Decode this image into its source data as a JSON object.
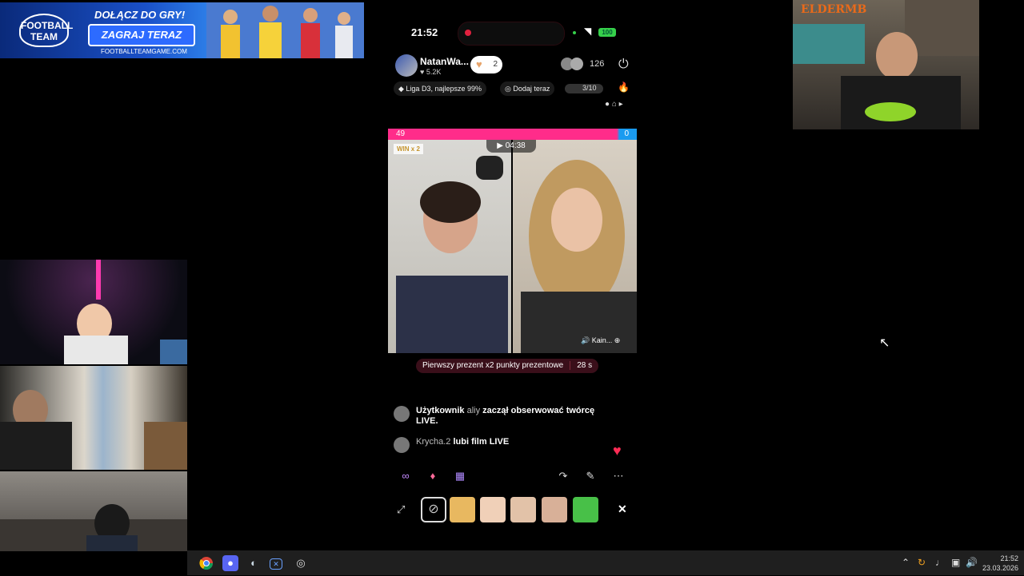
{
  "ad": {
    "logo": "FOOTBALL TEAM",
    "headline": "DOŁĄCZ DO GRY!",
    "cta": "ZAGRAJ TERAZ",
    "url": "FOOTBALLTEAMGAME.COM"
  },
  "cams": {
    "elder_name": "ELDERMB"
  },
  "phone": {
    "status": {
      "time": "21:52",
      "battery": "100"
    },
    "host": {
      "name": "NatanWa...",
      "likes": "5.2K",
      "gift_count": "2"
    },
    "viewers": "126",
    "chips": {
      "league": "Liga D3, najlepsze 99%",
      "add": "Dodaj teraz",
      "progress": "3/10"
    },
    "battle": {
      "score_left": "49",
      "score_right": "0",
      "win_badge": "WIN x 2",
      "timer": "04:38",
      "guest_label": "Kain..."
    },
    "promo": {
      "text": "Pierwszy prezent x2 punkty prezentowe",
      "seconds": "28 s"
    },
    "messages": [
      {
        "prefix": "Użytkownik",
        "user": "aliy",
        "text": "zaczął obserwować twórcę LIVE."
      },
      {
        "user": "Krycha.2",
        "text": "lubi film LIVE"
      }
    ],
    "close_label": "✕"
  },
  "taskbar": {
    "time": "21:52",
    "date": "23.03.2026"
  },
  "colors": {
    "pink": "#ff2c8a",
    "blue": "#1a9bf0",
    "heart": "#ff2c55",
    "battery": "#36d04b"
  }
}
